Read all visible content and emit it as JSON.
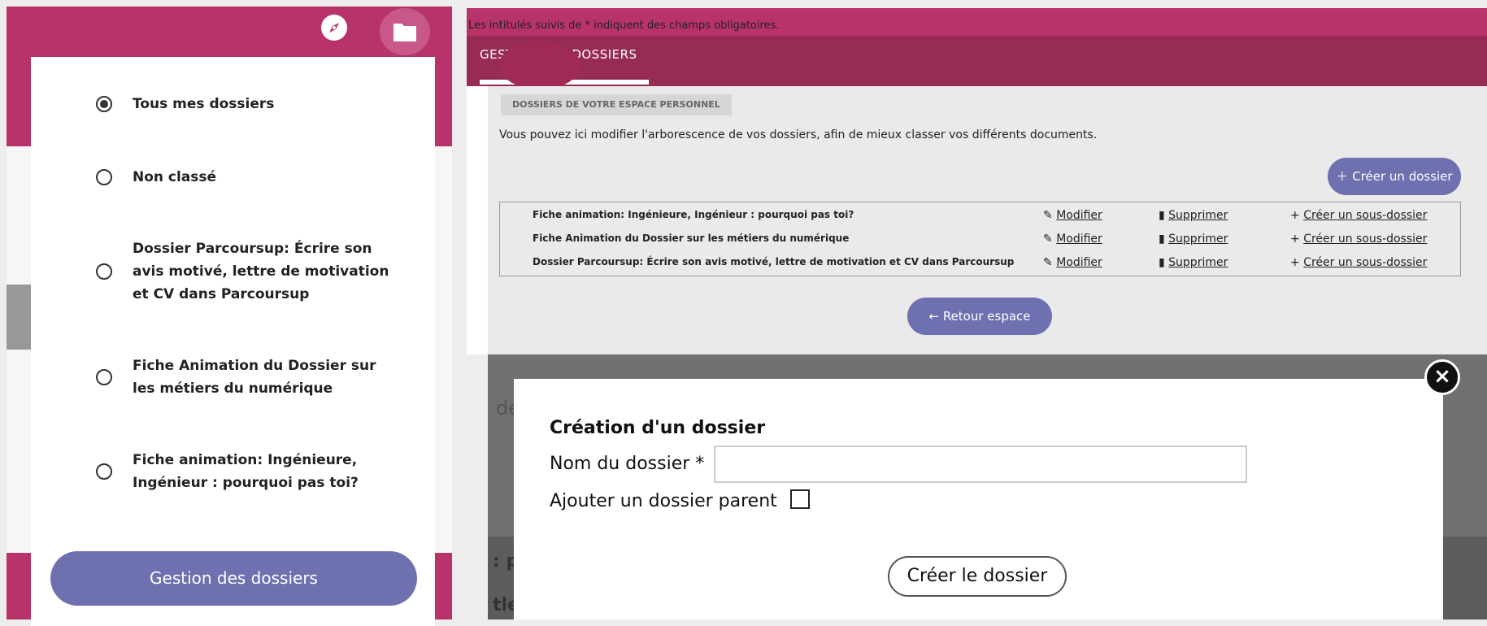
{
  "left_panel": {
    "radio_items": [
      {
        "label": "Tous mes dossiers",
        "selected": true
      },
      {
        "label": "Non classé",
        "selected": false
      },
      {
        "label": "Dossier Parcoursup: Écrire son avis motivé, lettre de motivation et CV dans Parcoursup",
        "selected": false
      },
      {
        "label": "Fiche Animation du Dossier sur les métiers du numérique",
        "selected": false
      },
      {
        "label": "Fiche animation: Ingénieure, Ingénieur : pourquoi pas toi?",
        "selected": false
      }
    ],
    "manage_button": "Gestion des dossiers",
    "icons": [
      "compass-icon",
      "folder-icon"
    ]
  },
  "header": {
    "required_notice": "Les intitulés suivis de * indiquent des champs obligatoires.",
    "tab": "GESTION DES DOSSIERS"
  },
  "main": {
    "section_label": "DOSSIERS DE VOTRE ESPACE PERSONNEL",
    "intro": "Vous pouvez ici modifier l'arborescence de vos dossiers, afin de mieux classer vos différents documents.",
    "create_button": "Créer un dossier",
    "rows": [
      {
        "name": "Fiche animation: Ingénieure, Ingénieur : pourquoi pas toi?",
        "edit": "Modifier",
        "delete": "Supprimer",
        "sub": "Créer un sous-dossier"
      },
      {
        "name": "Fiche Animation du Dossier sur les métiers du numérique",
        "edit": "Modifier",
        "delete": "Supprimer",
        "sub": "Créer un sous-dossier"
      },
      {
        "name": "Dossier Parcoursup: Écrire son avis motivé, lettre de motivation et CV dans Parcoursup",
        "edit": "Modifier",
        "delete": "Supprimer",
        "sub": "Créer un sous-dossier"
      }
    ],
    "back_button": "Retour espace"
  },
  "backdrop": {
    "text1": "de",
    "text2": ": p",
    "text3": "tle"
  },
  "modal": {
    "title": "Création d'un dossier",
    "name_label": "Nom du dossier *",
    "name_value": "",
    "parent_label": "Ajouter un dossier parent",
    "parent_checked": false,
    "submit": "Créer le dossier",
    "close_glyph": "×"
  },
  "colors": {
    "brand": "#b8336a",
    "brand_dark": "#962c55",
    "accent": "#6e70b0"
  }
}
